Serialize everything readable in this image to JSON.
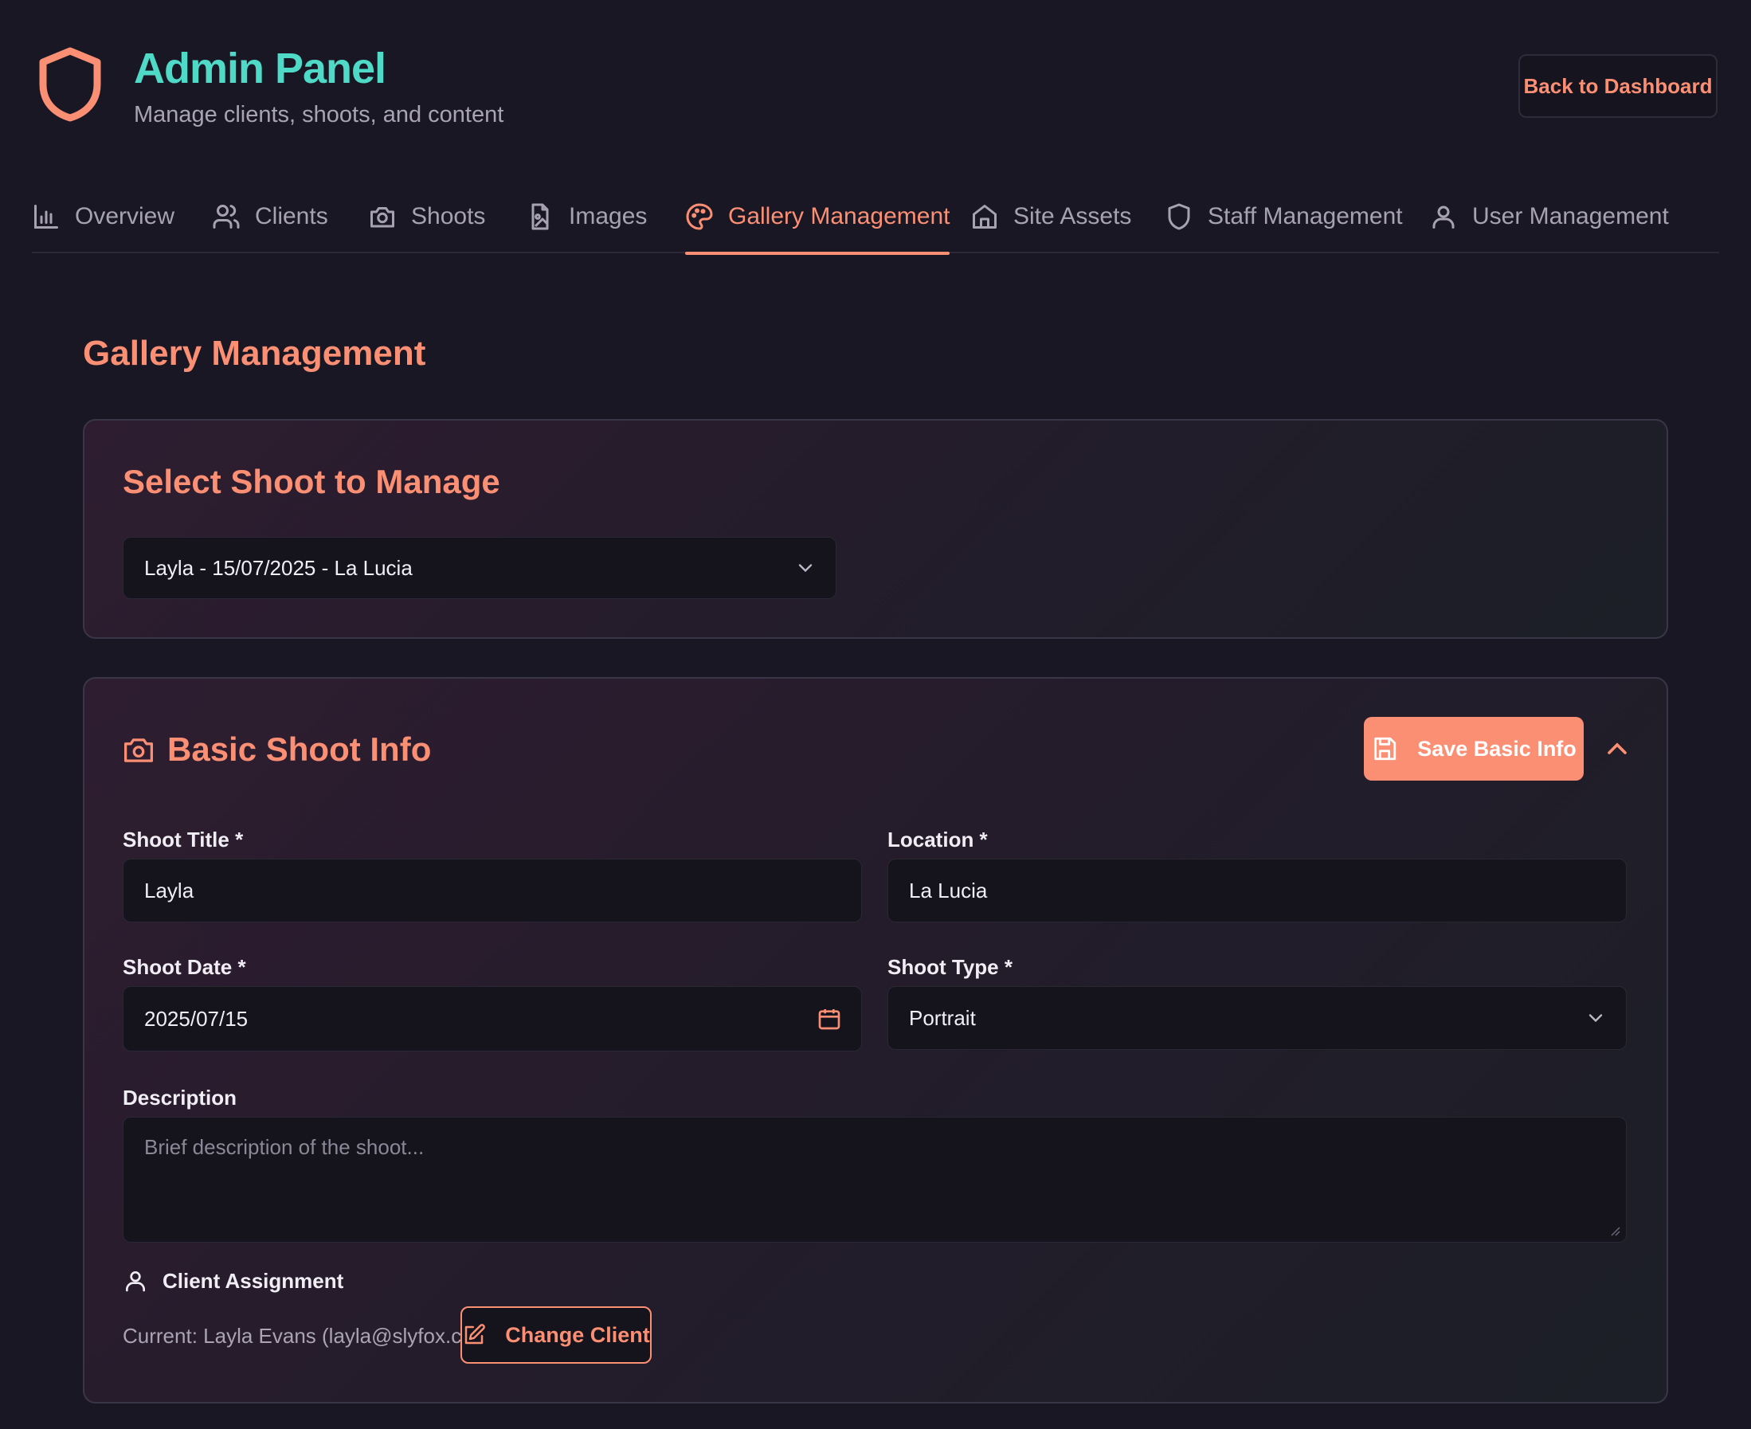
{
  "header": {
    "title": "Admin Panel",
    "subtitle": "Manage clients, shoots, and content",
    "back_button": "Back to Dashboard",
    "logo_icon": "shield-icon"
  },
  "tabs": [
    {
      "label": "Overview",
      "icon": "bar-chart-icon",
      "active": false
    },
    {
      "label": "Clients",
      "icon": "users-icon",
      "active": false
    },
    {
      "label": "Shoots",
      "icon": "camera-icon",
      "active": false
    },
    {
      "label": "Images",
      "icon": "image-file-icon",
      "active": false
    },
    {
      "label": "Gallery Management",
      "icon": "palette-icon",
      "active": true
    },
    {
      "label": "Site Assets",
      "icon": "home-icon",
      "active": false
    },
    {
      "label": "Staff Management",
      "icon": "shield-icon",
      "active": false
    },
    {
      "label": "User Management",
      "icon": "user-icon",
      "active": false
    }
  ],
  "page_title": "Gallery Management",
  "select_shoot": {
    "title": "Select Shoot to Manage",
    "selected": "Layla - 15/07/2025 - La Lucia"
  },
  "basic_info": {
    "title": "Basic Shoot Info",
    "save_label": "Save Basic Info",
    "fields": {
      "title_label": "Shoot Title *",
      "title_value": "Layla",
      "location_label": "Location *",
      "location_value": "La Lucia",
      "date_label": "Shoot Date *",
      "date_value": "2025/07/15",
      "type_label": "Shoot Type *",
      "type_value": "Portrait",
      "description_label": "Description",
      "description_placeholder": "Brief description of the shoot..."
    },
    "client": {
      "heading": "Client Assignment",
      "current": "Current: Layla Evans (layla@slyfox.co.za)",
      "change_label": "Change Client"
    }
  },
  "colors": {
    "accent": "#fb8f74",
    "brand_title": "#4fd9c7",
    "background": "#1a1724",
    "input_bg": "#15131b"
  }
}
